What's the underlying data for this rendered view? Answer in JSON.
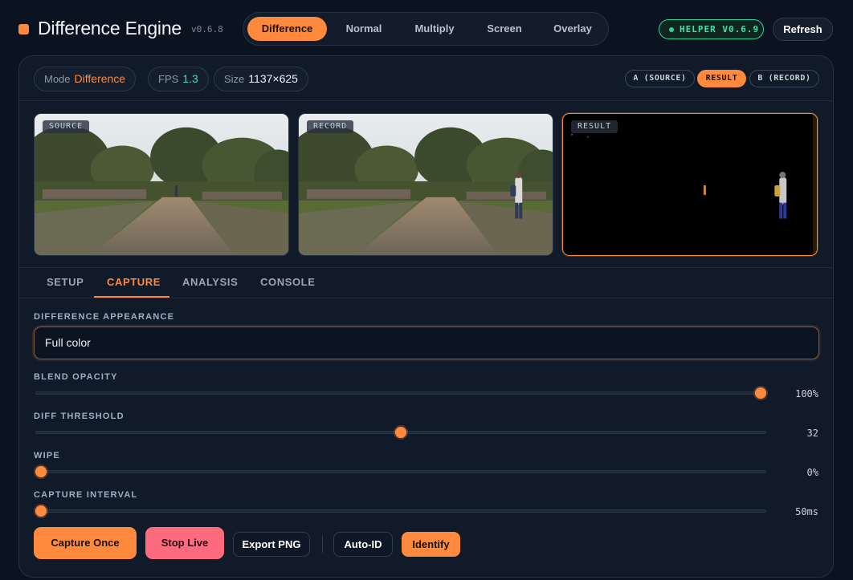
{
  "app": {
    "title": "Difference Engine",
    "version": "v0.6.8"
  },
  "modes": [
    {
      "label": "Difference",
      "active": true
    },
    {
      "label": "Normal",
      "active": false
    },
    {
      "label": "Multiply",
      "active": false
    },
    {
      "label": "Screen",
      "active": false
    },
    {
      "label": "Overlay",
      "active": false
    }
  ],
  "helper": {
    "label": "HELPER V0.6.9",
    "color": "#2bd49a"
  },
  "refresh_label": "Refresh",
  "stats": {
    "mode_key": "Mode",
    "mode_value": "Difference",
    "fps_key": "FPS",
    "fps_value": "1.3",
    "size_key": "Size",
    "size_value": "1137×625"
  },
  "view_toggle": [
    {
      "label": "A (SOURCE)",
      "active": false
    },
    {
      "label": "RESULT",
      "active": true
    },
    {
      "label": "B (RECORD)",
      "active": false
    }
  ],
  "panes": {
    "source": "SOURCE",
    "record": "RECORD",
    "result": "RESULT"
  },
  "tabs": [
    {
      "label": "SETUP",
      "active": false
    },
    {
      "label": "CAPTURE",
      "active": true
    },
    {
      "label": "ANALYSIS",
      "active": false
    },
    {
      "label": "CONSOLE",
      "active": false
    }
  ],
  "appearance": {
    "label": "DIFFERENCE APPEARANCE",
    "value": "Full color"
  },
  "sliders": [
    {
      "label": "BLEND OPACITY",
      "value_text": "100%",
      "fraction": 1.0
    },
    {
      "label": "DIFF THRESHOLD",
      "value_text": "32",
      "fraction": 0.5
    },
    {
      "label": "WIPE",
      "value_text": "0%",
      "fraction": 0.0
    },
    {
      "label": "CAPTURE INTERVAL",
      "value_text": "50ms",
      "fraction": 0.0
    }
  ],
  "actions": {
    "capture_once": "Capture Once",
    "stop_live": "Stop Live",
    "export_png": "Export PNG",
    "auto_id": "Auto-ID",
    "identify": "Identify"
  },
  "colors": {
    "accent": "#ff8a3d",
    "danger": "#ff6b7e",
    "success": "#44e0a8"
  }
}
